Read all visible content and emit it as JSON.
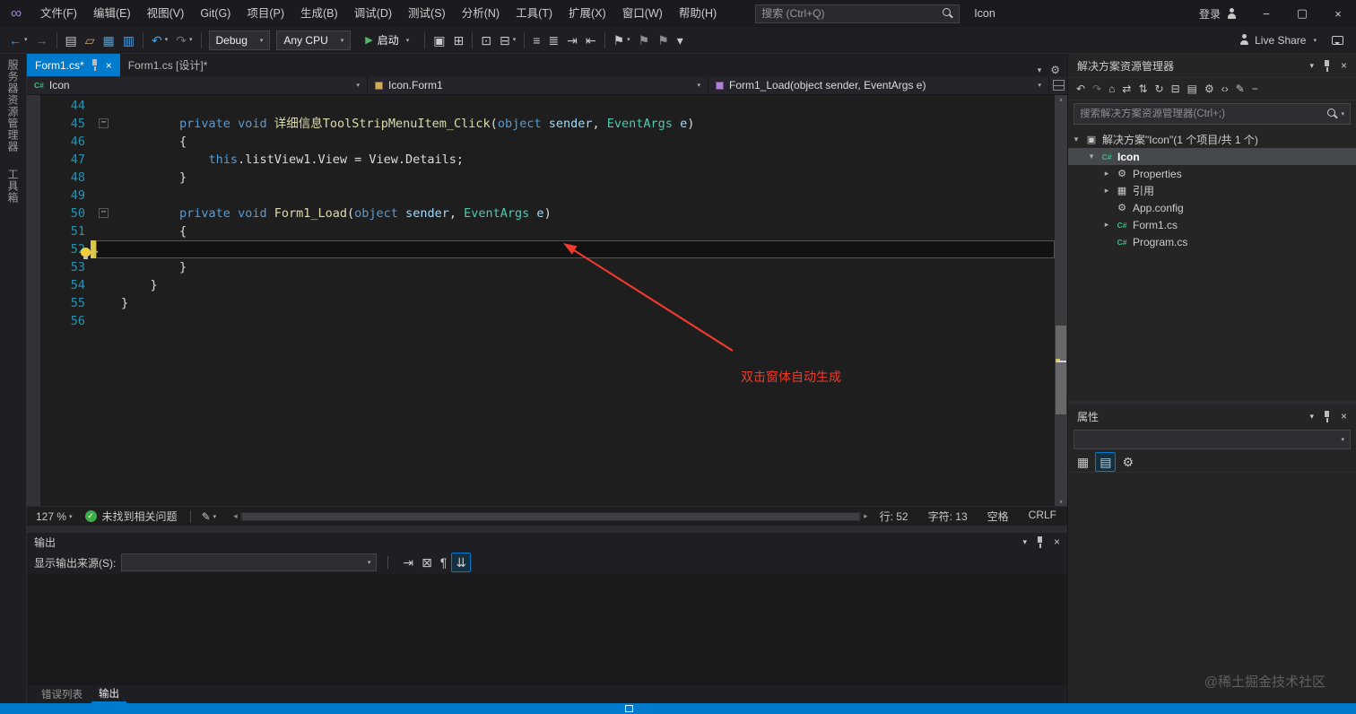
{
  "titlebar": {
    "menus": [
      {
        "name": "menu-file",
        "label": "文件(F)"
      },
      {
        "name": "menu-edit",
        "label": "编辑(E)"
      },
      {
        "name": "menu-view",
        "label": "视图(V)"
      },
      {
        "name": "menu-git",
        "label": "Git(G)"
      },
      {
        "name": "menu-project",
        "label": "项目(P)"
      },
      {
        "name": "menu-build",
        "label": "生成(B)"
      },
      {
        "name": "menu-debug",
        "label": "调试(D)"
      },
      {
        "name": "menu-test",
        "label": "测试(S)"
      },
      {
        "name": "menu-analyze",
        "label": "分析(N)"
      },
      {
        "name": "menu-tools",
        "label": "工具(T)"
      },
      {
        "name": "menu-extensions",
        "label": "扩展(X)"
      },
      {
        "name": "menu-window",
        "label": "窗口(W)"
      },
      {
        "name": "menu-help",
        "label": "帮助(H)"
      }
    ],
    "search_placeholder": "搜索 (Ctrl+Q)",
    "window_title": "Icon",
    "sign_in_label": "登录"
  },
  "toolbar": {
    "left_icons": [
      {
        "name": "back-icon",
        "glyph": "←",
        "color": "#4aa0e0",
        "caret": true
      },
      {
        "name": "forward-icon",
        "glyph": "→",
        "color": "#6f6f73"
      },
      {
        "name": "sep"
      },
      {
        "name": "new-project-icon",
        "glyph": "▤",
        "color": "#c8c8c8"
      },
      {
        "name": "open-folder-icon",
        "glyph": "▱",
        "color": "#c8a978"
      },
      {
        "name": "save-icon",
        "glyph": "▦",
        "color": "#4aa0e0"
      },
      {
        "name": "save-all-icon",
        "glyph": "▥",
        "color": "#4aa0e0"
      },
      {
        "name": "sep"
      },
      {
        "name": "undo-icon",
        "glyph": "↶",
        "color": "#4aa0e0",
        "caret": true
      },
      {
        "name": "redo-icon",
        "glyph": "↷",
        "color": "#6f6f73",
        "caret": true
      },
      {
        "name": "sep"
      }
    ],
    "config_value": "Debug",
    "platform_value": "Any CPU",
    "start_label": "启动",
    "debug_icons": [
      {
        "name": "sep"
      },
      {
        "name": "hot-reload-icon",
        "glyph": "▣",
        "color": "#c8c8c8"
      },
      {
        "name": "breakpoints-window-icon",
        "glyph": "⊞",
        "color": "#c8c8c8"
      },
      {
        "name": "sep"
      },
      {
        "name": "find-in-files-icon",
        "glyph": "⊡",
        "color": "#c8c8c8"
      },
      {
        "name": "navigate-window-icon",
        "glyph": "⊟",
        "color": "#c8c8c8",
        "caret": true
      },
      {
        "name": "sep"
      },
      {
        "name": "comment-icon",
        "glyph": "≡",
        "color": "#c8c8c8"
      },
      {
        "name": "uncomment-icon",
        "glyph": "≣",
        "color": "#c8c8c8"
      },
      {
        "name": "indent-icon",
        "glyph": "⇥",
        "color": "#c8c8c8"
      },
      {
        "name": "outdent-icon",
        "glyph": "⇤",
        "color": "#c8c8c8"
      },
      {
        "name": "sep"
      },
      {
        "name": "bookmark-icon",
        "glyph": "⚑",
        "color": "#c8c8c8",
        "caret": true
      },
      {
        "name": "previous-bookmark-icon",
        "glyph": "⚑",
        "color": "#8f8f93"
      },
      {
        "name": "next-bookmark-icon",
        "glyph": "⚑",
        "color": "#8f8f93"
      },
      {
        "name": "toolbar-overflow-icon",
        "glyph": "▾",
        "color": "#c8c8c8"
      }
    ],
    "live_share_label": "Live Share"
  },
  "left_rail": {
    "tabs": [
      {
        "name": "server-explorer-rail-tab",
        "label": "服务器资源管理器"
      },
      {
        "name": "toolbox-rail-tab",
        "label": "工具箱"
      }
    ]
  },
  "editor_tabs": [
    {
      "name": "tab-form1-cs",
      "label": "Form1.cs*",
      "active": true
    },
    {
      "name": "tab-form1-cs-design",
      "label": "Form1.cs [设计]*",
      "active": false
    }
  ],
  "navbar": {
    "project": "Icon",
    "type": "Icon.Form1",
    "member": "Form1_Load(object sender, EventArgs e)"
  },
  "code": {
    "lines": [
      {
        "num": 44,
        "segments": []
      },
      {
        "num": 45,
        "indent": 2,
        "fold": true,
        "segments": [
          [
            "kw",
            "private"
          ],
          [
            "pl",
            " "
          ],
          [
            "kw",
            "void"
          ],
          [
            "pl",
            " "
          ],
          [
            "md",
            "详细信息ToolStripMenuItem_Click"
          ],
          [
            "pl",
            "("
          ],
          [
            "kw",
            "object"
          ],
          [
            "pl",
            " "
          ],
          [
            "pm",
            "sender"
          ],
          [
            "pl",
            ", "
          ],
          [
            "ty",
            "EventArgs"
          ],
          [
            "pl",
            " "
          ],
          [
            "pm",
            "e"
          ],
          [
            "pl",
            ")"
          ]
        ]
      },
      {
        "num": 46,
        "indent": 2,
        "segments": [
          [
            "pl",
            "{"
          ]
        ]
      },
      {
        "num": 47,
        "indent": 3,
        "segments": [
          [
            "kw",
            "this"
          ],
          [
            "pl",
            ".listView1.View = View.Details;"
          ]
        ]
      },
      {
        "num": 48,
        "indent": 2,
        "segments": [
          [
            "pl",
            "}"
          ]
        ]
      },
      {
        "num": 49,
        "segments": []
      },
      {
        "num": 50,
        "indent": 2,
        "fold": true,
        "segments": [
          [
            "kw",
            "private"
          ],
          [
            "pl",
            " "
          ],
          [
            "kw",
            "void"
          ],
          [
            "pl",
            " "
          ],
          [
            "md",
            "Form1_Load"
          ],
          [
            "pl",
            "("
          ],
          [
            "kw",
            "object"
          ],
          [
            "pl",
            " "
          ],
          [
            "pm",
            "sender"
          ],
          [
            "pl",
            ", "
          ],
          [
            "ty",
            "EventArgs"
          ],
          [
            "pl",
            " "
          ],
          [
            "pm",
            "e"
          ],
          [
            "pl",
            ")"
          ]
        ]
      },
      {
        "num": 51,
        "indent": 2,
        "segments": [
          [
            "pl",
            "{"
          ]
        ]
      },
      {
        "num": 52,
        "indent": 3,
        "current": true,
        "changed": true,
        "bulb": true,
        "segments": []
      },
      {
        "num": 53,
        "indent": 2,
        "segments": [
          [
            "pl",
            "}"
          ]
        ]
      },
      {
        "num": 54,
        "indent": 1,
        "segments": [
          [
            "pl",
            "}"
          ]
        ]
      },
      {
        "num": 55,
        "indent": 0,
        "segments": [
          [
            "pl",
            "}"
          ]
        ]
      },
      {
        "num": 56,
        "segments": []
      }
    ]
  },
  "annotation": {
    "text": "双击窗体自动生成"
  },
  "editor_status": {
    "zoom": "127 %",
    "health_text": "未找到相关问题",
    "line_label": "行: 52",
    "column_label": "字符: 13",
    "spaces_label": "空格",
    "line_ending": "CRLF"
  },
  "output": {
    "title": "输出",
    "source_label": "显示输出来源(S):",
    "toolbar_icons": [
      {
        "name": "goto-message-icon",
        "glyph": "⇥",
        "color": "#c8c8c8"
      },
      {
        "name": "clear-all-icon",
        "glyph": "⊠",
        "color": "#c8c8c8"
      },
      {
        "name": "wrap-icon",
        "glyph": "¶",
        "color": "#c8c8c8"
      },
      {
        "name": "autoscroll-icon",
        "glyph": "⇊",
        "color": "#c8c8c8",
        "pressed": true
      }
    ]
  },
  "bottom_tabs": [
    {
      "name": "error-list-tab",
      "label": "错误列表",
      "active": false
    },
    {
      "name": "output-tab",
      "label": "输出",
      "active": true
    }
  ],
  "solution_explorer": {
    "title": "解决方案资源管理器",
    "toolbar_icons": [
      {
        "name": "back-icon",
        "glyph": "↶",
        "color": "#c8c8c8"
      },
      {
        "name": "forward-icon",
        "glyph": "↷",
        "color": "#6f6f73"
      },
      {
        "name": "home-icon",
        "glyph": "⌂",
        "color": "#c8c8c8"
      },
      {
        "name": "switch-views-icon",
        "glyph": "⇄",
        "color": "#c8c8c8"
      },
      {
        "name": "sync-icon",
        "glyph": "⇅",
        "color": "#c8c8c8"
      },
      {
        "name": "refresh-icon",
        "glyph": "↻",
        "color": "#c8c8c8"
      },
      {
        "name": "collapse-all-icon",
        "glyph": "⊟",
        "color": "#c8c8c8"
      },
      {
        "name": "show-all-files-icon",
        "glyph": "▤",
        "color": "#c8c8c8"
      },
      {
        "name": "properties-icon",
        "glyph": "⚙",
        "color": "#c8c8c8"
      },
      {
        "name": "code-view-icon",
        "glyph": "‹›",
        "color": "#c8c8c8"
      },
      {
        "name": "edit-icon",
        "glyph": "✎",
        "color": "#c8c8c8"
      },
      {
        "name": "minimize-results-icon",
        "glyph": "−",
        "color": "#c8c8c8"
      }
    ],
    "search_placeholder": "搜索解决方案资源管理器(Ctrl+;)",
    "tree": [
      {
        "name": "solution-node",
        "label": "解决方案\"Icon\"(1 个项目/共 1 个)",
        "icon": "solution",
        "expander": "expanded",
        "level": 0
      },
      {
        "name": "project-node",
        "label": "Icon",
        "icon": "csproj",
        "expander": "expanded",
        "level": 1,
        "selected": true,
        "bold": true
      },
      {
        "name": "properties-node",
        "label": "Properties",
        "icon": "properties",
        "expander": "collapsed",
        "level": 2
      },
      {
        "name": "references-node",
        "label": "引用",
        "icon": "references",
        "expander": "collapsed",
        "level": 2
      },
      {
        "name": "app-config-node",
        "label": "App.config",
        "icon": "config",
        "level": 2
      },
      {
        "name": "form1-node",
        "label": "Form1.cs",
        "icon": "csfile",
        "expander": "collapsed",
        "level": 2
      },
      {
        "name": "program-node",
        "label": "Program.cs",
        "icon": "csfile",
        "level": 2
      }
    ]
  },
  "properties_panel": {
    "title": "属性",
    "toolbar_icons": [
      {
        "name": "categorized-icon",
        "glyph": "▦",
        "color": "#c8c8c8"
      },
      {
        "name": "alphabetical-icon",
        "glyph": "▤",
        "color": "#c8c8c8",
        "pressed": true
      },
      {
        "name": "property-pages-icon",
        "glyph": "⚙",
        "color": "#c8c8c8"
      }
    ]
  },
  "watermark": "@稀土掘金技术社区"
}
